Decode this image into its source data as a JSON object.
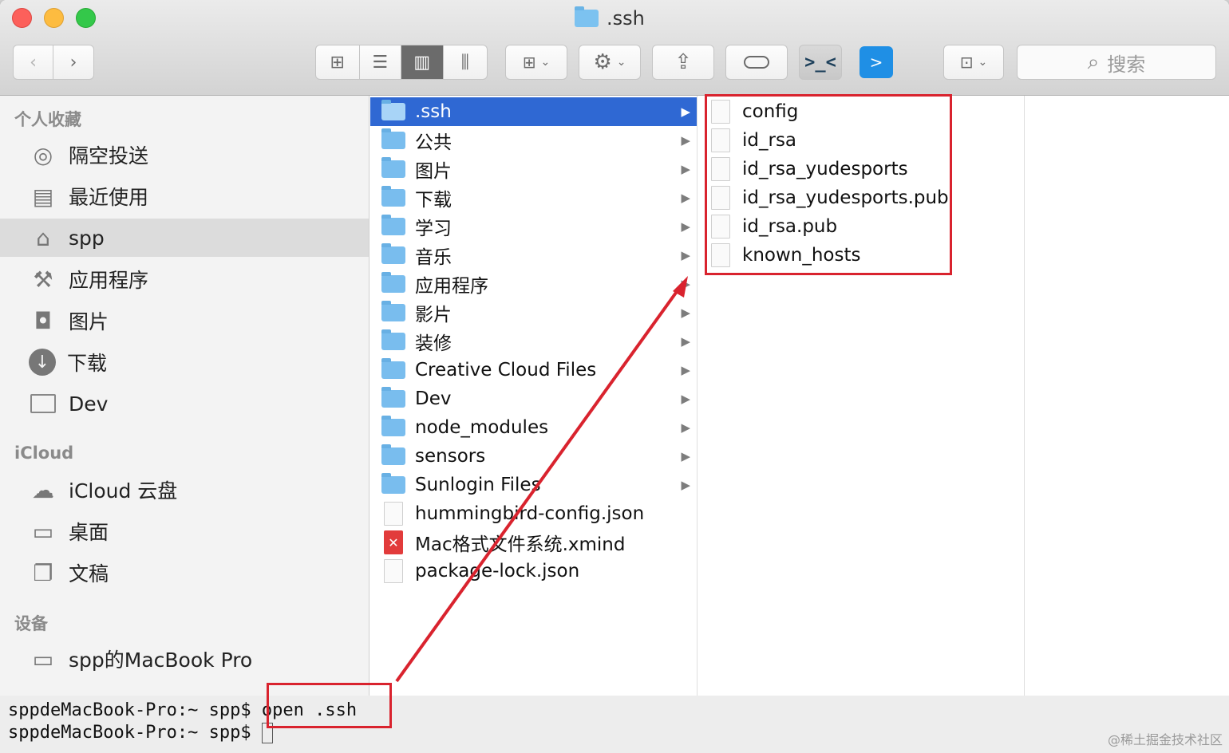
{
  "window": {
    "title": ".ssh",
    "search_placeholder": "搜索"
  },
  "toolbar": {
    "back_icon": "chevron-left-icon",
    "forward_icon": "chevron-right-icon",
    "view_modes": [
      "icon-view",
      "list-view",
      "column-view",
      "gallery-view"
    ],
    "active_view": "column-view"
  },
  "sidebar": {
    "sections": [
      {
        "label": "个人收藏"
      },
      {
        "label": "iCloud"
      },
      {
        "label": "设备"
      }
    ],
    "favorites": [
      {
        "label": "隔空投送",
        "icon": "airdrop-icon"
      },
      {
        "label": "最近使用",
        "icon": "recents-icon"
      },
      {
        "label": "spp",
        "icon": "home-icon",
        "selected": true
      },
      {
        "label": "应用程序",
        "icon": "applications-icon"
      },
      {
        "label": "图片",
        "icon": "camera-icon"
      },
      {
        "label": "下载",
        "icon": "download-icon"
      },
      {
        "label": "Dev",
        "icon": "folder-icon"
      }
    ],
    "icloud": [
      {
        "label": "iCloud 云盘",
        "icon": "cloud-icon"
      },
      {
        "label": "桌面",
        "icon": "desktop-icon"
      },
      {
        "label": "文稿",
        "icon": "documents-icon"
      }
    ],
    "devices": [
      {
        "label": "spp的MacBook Pro",
        "icon": "laptop-icon"
      }
    ]
  },
  "column1": [
    {
      "name": ".ssh",
      "type": "folder",
      "selected": true
    },
    {
      "name": "公共",
      "type": "folder"
    },
    {
      "name": "图片",
      "type": "folder"
    },
    {
      "name": "下载",
      "type": "folder"
    },
    {
      "name": "学习",
      "type": "folder"
    },
    {
      "name": "音乐",
      "type": "folder"
    },
    {
      "name": "应用程序",
      "type": "folder"
    },
    {
      "name": "影片",
      "type": "folder"
    },
    {
      "name": "装修",
      "type": "folder"
    },
    {
      "name": "Creative Cloud Files",
      "type": "folder"
    },
    {
      "name": "Dev",
      "type": "folder"
    },
    {
      "name": "node_modules",
      "type": "folder"
    },
    {
      "name": "sensors",
      "type": "folder"
    },
    {
      "name": "Sunlogin Files",
      "type": "folder"
    },
    {
      "name": "hummingbird-config.json",
      "type": "file"
    },
    {
      "name": "Mac格式文件系统.xmind",
      "type": "xmind"
    },
    {
      "name": "package-lock.json",
      "type": "file"
    }
  ],
  "column2": [
    {
      "name": "config"
    },
    {
      "name": "id_rsa"
    },
    {
      "name": "id_rsa_yudesports"
    },
    {
      "name": "id_rsa_yudesports.pub"
    },
    {
      "name": "id_rsa.pub"
    },
    {
      "name": "known_hosts"
    }
  ],
  "terminal": {
    "line1_prompt": "sppdeMacBook-Pro:~ spp$ ",
    "line1_command": "open .ssh",
    "line2_prompt": "sppdeMacBook-Pro:~ spp$ "
  },
  "watermark": "@稀土掘金技术社区",
  "colors": {
    "selection": "#2f68d3",
    "annotation_red": "#d9232e",
    "folder_blue": "#79bdee"
  }
}
